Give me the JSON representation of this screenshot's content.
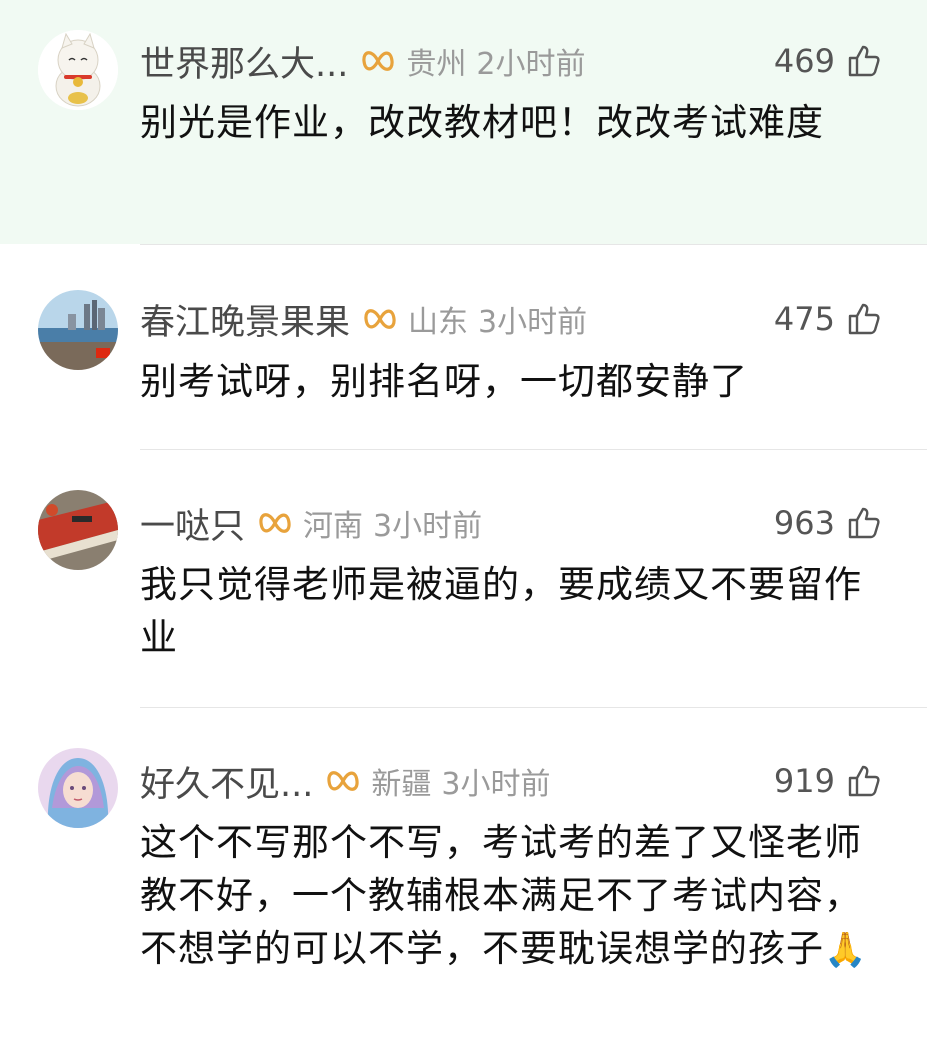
{
  "comments": [
    {
      "name": "世界那么大...",
      "location": "贵州",
      "time": "2小时前",
      "likes": "469",
      "text": "别光是作业，改改教材吧！改改考试难度",
      "emoji": ""
    },
    {
      "name": "春江晚景果果",
      "location": "山东",
      "time": "3小时前",
      "likes": "475",
      "text": "别考试呀，别排名呀，一切都安静了",
      "emoji": ""
    },
    {
      "name": "一哒只",
      "location": "河南",
      "time": "3小时前",
      "likes": "963",
      "text": "我只觉得老师是被逼的，要成绩又不要留作业",
      "emoji": ""
    },
    {
      "name": "好久不见...",
      "location": "新疆",
      "time": "3小时前",
      "likes": "919",
      "text": "这个不写那个不写，考试考的差了又怪老师教不好，一个教辅根本满足不了考试内容，不想学的可以不学，不要耽误想学的孩子",
      "emoji": "🙏"
    }
  ],
  "colors": {
    "highlight": "#f1faf3",
    "badge": "#e8a33c",
    "meta": "#9a9a9a"
  },
  "icons": {
    "like": "thumbs-up-icon",
    "badge": "infinity-badge-icon"
  }
}
